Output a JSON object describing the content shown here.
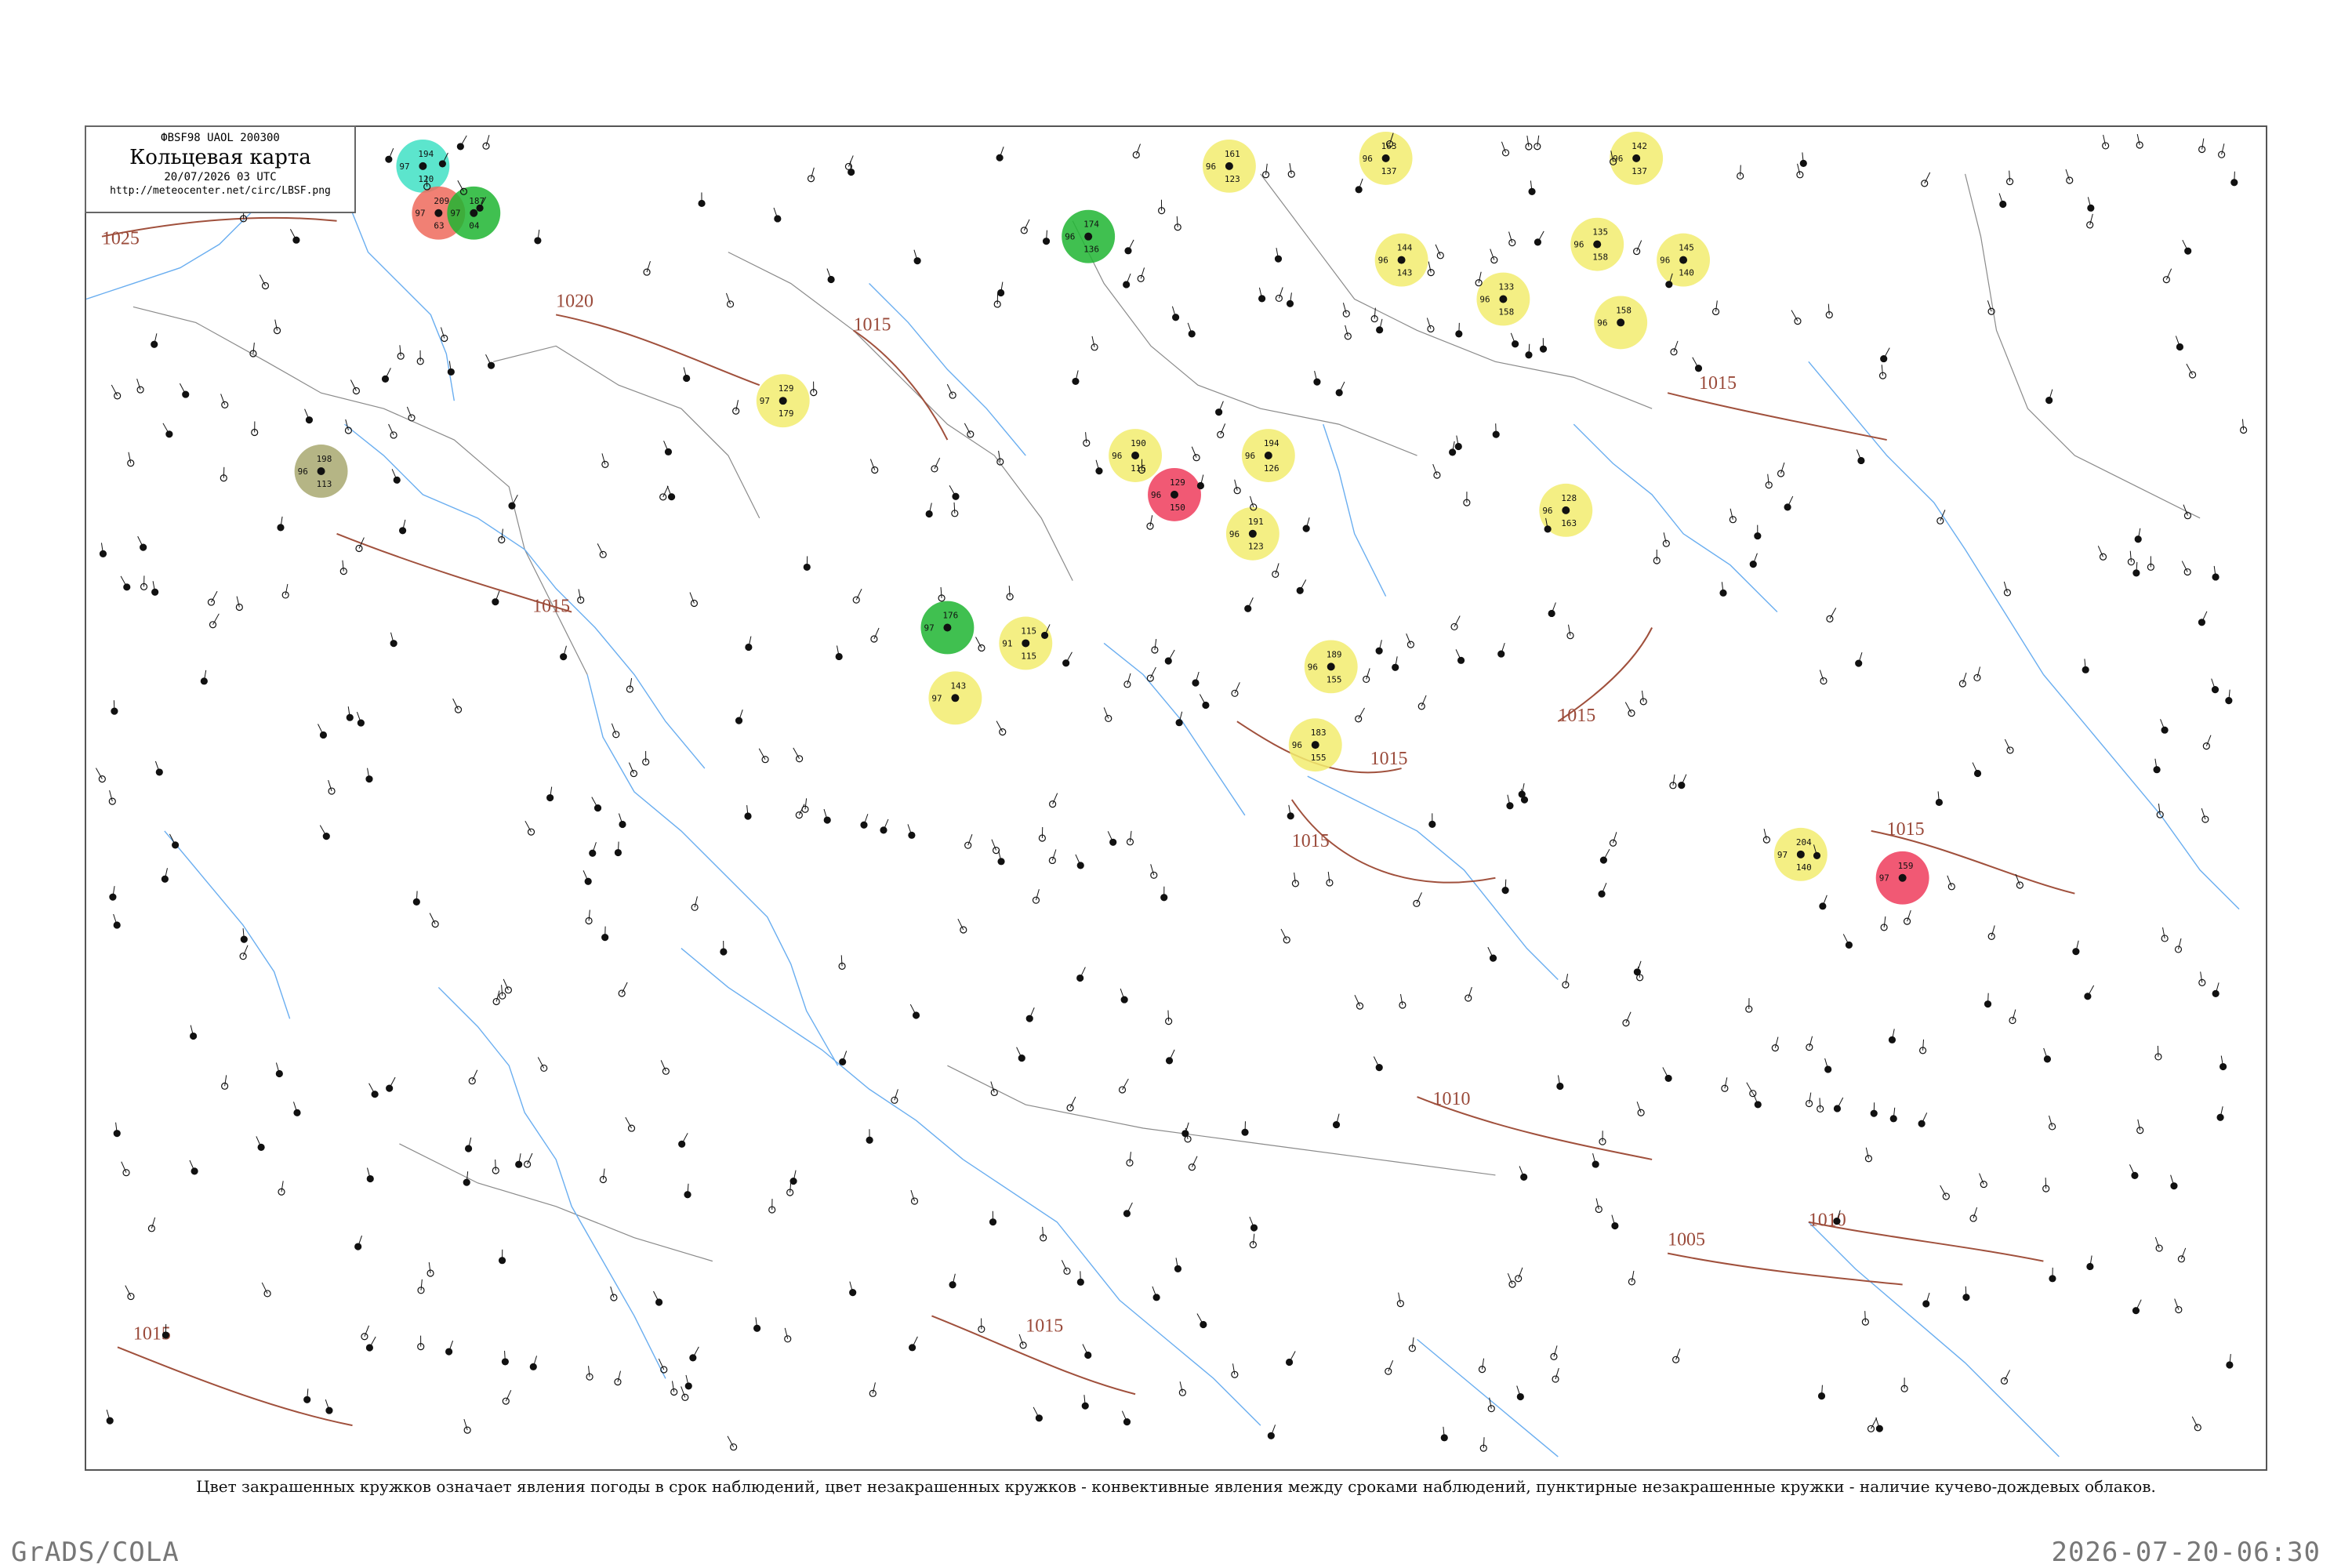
{
  "header": {
    "code": "ФBSF98  UAOL  200300",
    "title": "Кольцевая карта",
    "date": "20/07/2026 03 UTC",
    "url": "http://meteocenter.net/circ/LBSF.png"
  },
  "caption": "Цвет закрашенных кружков означает явления погоды в срок наблюдений, цвет незакрашенных кружков - конвективные явления между сроками наблюдений, пунктирные незакрашенные кружки - наличие кучево-дождевых облаков.",
  "footer": {
    "left": "GrADS/COLA",
    "right": "2026-07-20-06:30"
  },
  "colors": {
    "coast": "#6aaef0",
    "border": "#8a8a8a",
    "isobar": "#a0503c",
    "yellow": "#f2ec6e",
    "green": "#1fb531",
    "red": "#ef3c5c",
    "salmon": "#ef6a5c",
    "cyan": "#3fe0c4",
    "olive": "#a8a870"
  },
  "isobars": [
    {
      "label": "1025"
    },
    {
      "label": "1020"
    },
    {
      "label": "1015"
    },
    {
      "label": "1015"
    },
    {
      "label": "1015"
    },
    {
      "label": "1015"
    },
    {
      "label": "1015"
    },
    {
      "label": "1015"
    },
    {
      "label": "1015"
    },
    {
      "label": "1015"
    },
    {
      "label": "1015"
    },
    {
      "label": "1010"
    },
    {
      "label": "1010"
    },
    {
      "label": "1005"
    }
  ],
  "stations": [
    {
      "top": "194",
      "bl": "97",
      "br": "120",
      "kind": "cyan"
    },
    {
      "top": "209",
      "bl": "97",
      "br": "63",
      "kind": "salmon"
    },
    {
      "top": "187",
      "bl": "97",
      "br": "04",
      "kind": "green"
    },
    {
      "top": "198",
      "bl": "96",
      "br": "113",
      "kind": "olive"
    },
    {
      "top": "129",
      "bl": "97",
      "br": "179",
      "kind": "yellow"
    },
    {
      "top": "161",
      "bl": "96",
      "br": "123",
      "kind": "yellow"
    },
    {
      "top": "190",
      "bl": "96",
      "br": "115",
      "kind": "yellow"
    },
    {
      "top": "174",
      "bl": "96",
      "br": "136",
      "kind": "green"
    },
    {
      "top": "129",
      "bl": "96",
      "br": "150",
      "kind": "red"
    },
    {
      "top": "194",
      "bl": "96",
      "br": "126",
      "kind": "yellow"
    },
    {
      "top": "191",
      "bl": "96",
      "br": "123",
      "kind": "yellow"
    },
    {
      "top": "115",
      "bl": "91",
      "br": "115",
      "kind": "yellow"
    },
    {
      "top": "143",
      "bl": "97",
      "br": "",
      "kind": "yellow"
    },
    {
      "top": "176",
      "bl": "97",
      "br": "",
      "kind": "green"
    },
    {
      "top": "163",
      "bl": "96",
      "br": "137",
      "kind": "yellow"
    },
    {
      "top": "144",
      "bl": "96",
      "br": "143",
      "kind": "yellow"
    },
    {
      "top": "142",
      "bl": "96",
      "br": "137",
      "kind": "yellow"
    },
    {
      "top": "145",
      "bl": "96",
      "br": "140",
      "kind": "yellow"
    },
    {
      "top": "128",
      "bl": "96",
      "br": "163",
      "kind": "yellow"
    },
    {
      "top": "189",
      "bl": "96",
      "br": "155",
      "kind": "yellow"
    },
    {
      "top": "183",
      "bl": "96",
      "br": "155",
      "kind": "yellow"
    },
    {
      "top": "204",
      "bl": "97",
      "br": "140",
      "kind": "yellow"
    },
    {
      "top": "159",
      "bl": "97",
      "br": "",
      "kind": "red"
    },
    {
      "top": "135",
      "bl": "96",
      "br": "158",
      "kind": "yellow"
    },
    {
      "top": "158",
      "bl": "96",
      "br": "",
      "kind": "yellow"
    },
    {
      "top": "133",
      "bl": "96",
      "br": "158",
      "kind": "yellow"
    }
  ]
}
